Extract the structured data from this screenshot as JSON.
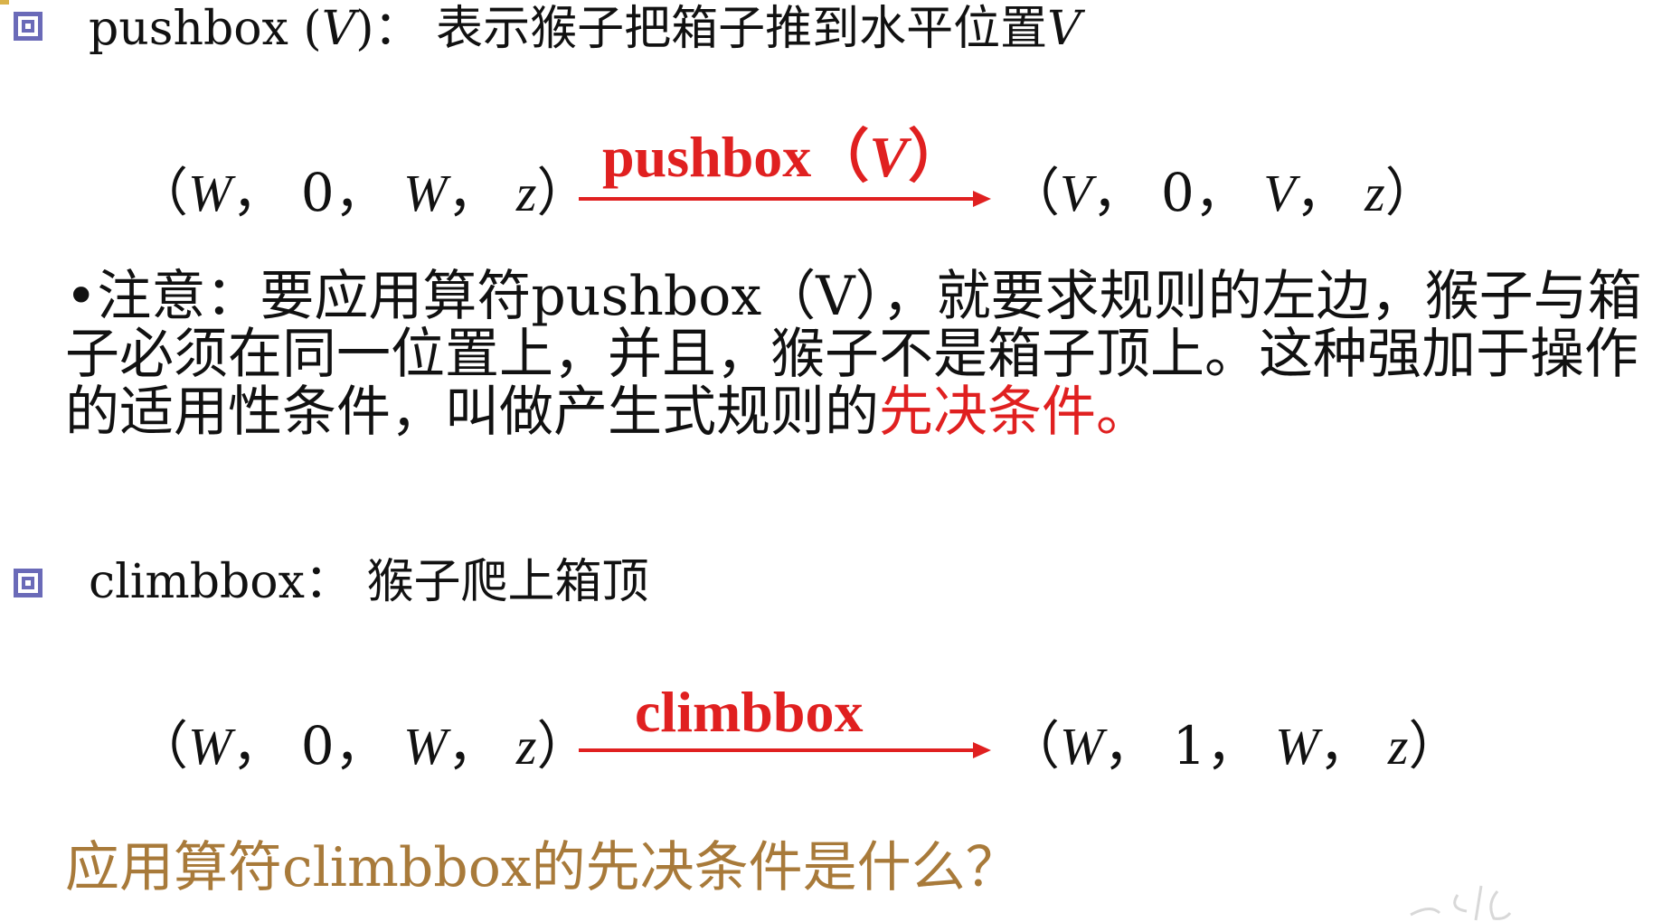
{
  "sections": [
    {
      "heading": {
        "name": "pushbox",
        "param": "V",
        "desc": "表示猴子把箱子推到水平位置",
        "desc_var": "V"
      },
      "rule": {
        "left": [
          "W",
          "0",
          "W",
          "z"
        ],
        "operator": "pushbox",
        "operator_param": "V",
        "right": [
          "V",
          "0",
          "V",
          "z"
        ]
      },
      "note": {
        "text_before": "•注意：要应用算符pushbox（V），就要求规则的左边，猴子与箱子必须在同一位置上，并且，猴子不是箱子顶上。这种强加于操作的适用性条件，叫做产生式规则的",
        "highlight": "先决条件。"
      }
    },
    {
      "heading": {
        "name": "climbbox",
        "desc": "猴子爬上箱顶"
      },
      "rule": {
        "left": [
          "W",
          "0",
          "W",
          "z"
        ],
        "operator": "climbbox",
        "right": [
          "W",
          "1",
          "W",
          "z"
        ]
      }
    }
  ],
  "question": "应用算符climbbox的先决条件是什么？",
  "colors": {
    "operator": "#e02020",
    "highlight": "#e02020",
    "question": "#a87a3a",
    "bullet": "#5a5aa8"
  }
}
